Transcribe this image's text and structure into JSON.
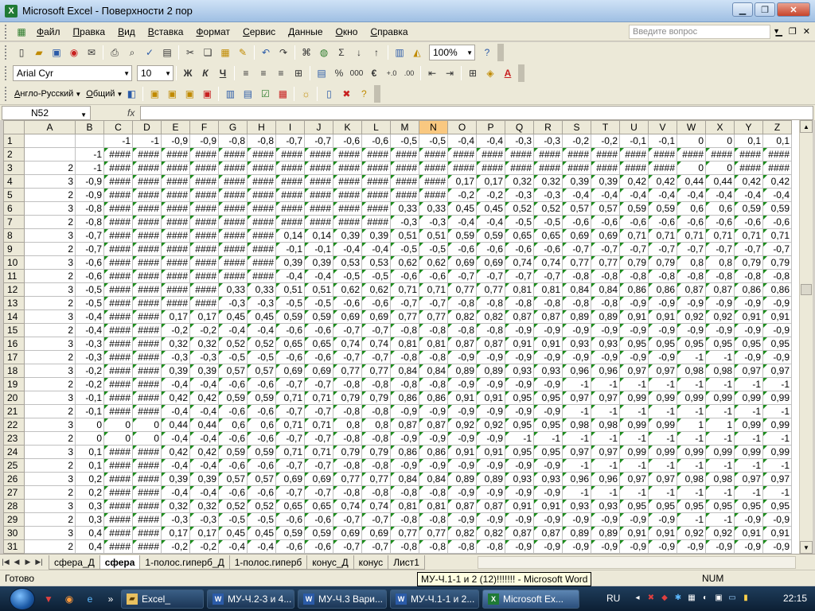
{
  "window": {
    "title": "Microsoft Excel - Поверхности 2 пор"
  },
  "menu": {
    "items": [
      "Файл",
      "Правка",
      "Вид",
      "Вставка",
      "Формат",
      "Сервис",
      "Данные",
      "Окно",
      "Справка"
    ],
    "question_placeholder": "Введите вопрос"
  },
  "toolbar": {
    "zoom": "100%",
    "font_name": "Arial Cyr",
    "font_size": "10",
    "bold": "Ж",
    "italic": "К",
    "underline": "Ч",
    "percent": "%",
    "thousands": "000",
    "euro": "€",
    "language": "Англо-Русский",
    "dictionary": "Общий"
  },
  "formula_bar": {
    "name_box": "N52",
    "fx_label": "fx",
    "formula": ""
  },
  "sheet": {
    "columns": [
      "A",
      "B",
      "C",
      "D",
      "E",
      "F",
      "G",
      "H",
      "I",
      "J",
      "K",
      "L",
      "M",
      "N",
      "O",
      "P",
      "Q",
      "R",
      "S",
      "T",
      "U",
      "V",
      "W",
      "X",
      "Y",
      "Z"
    ],
    "selected_column": "N",
    "rows": [
      {
        "n": "1",
        "c": [
          "",
          "",
          "-1",
          "-1",
          "-0,9",
          "-0,9",
          "-0,8",
          "-0,8",
          "-0,7",
          "-0,7",
          "-0,6",
          "-0,6",
          "-0,5",
          "-0,5",
          "-0,4",
          "-0,4",
          "-0,3",
          "-0,3",
          "-0,2",
          "-0,2",
          "-0,1",
          "-0,1",
          "0",
          "0",
          "0,1",
          "0,1"
        ]
      },
      {
        "n": "2",
        "c": [
          "",
          "-1",
          "####",
          "####",
          "####",
          "####",
          "####",
          "####",
          "####",
          "####",
          "####",
          "####",
          "####",
          "####",
          "####",
          "####",
          "####",
          "####",
          "####",
          "####",
          "####",
          "####",
          "####",
          "####",
          "####",
          "####"
        ]
      },
      {
        "n": "3",
        "c": [
          "2",
          "-1",
          "####",
          "####",
          "####",
          "####",
          "####",
          "####",
          "####",
          "####",
          "####",
          "####",
          "####",
          "####",
          "####",
          "####",
          "####",
          "####",
          "####",
          "####",
          "####",
          "####",
          "0",
          "0",
          "####",
          "####"
        ]
      },
      {
        "n": "4",
        "c": [
          "3",
          "-0,9",
          "####",
          "####",
          "####",
          "####",
          "####",
          "####",
          "####",
          "####",
          "####",
          "####",
          "####",
          "####",
          "0,17",
          "0,17",
          "0,32",
          "0,32",
          "0,39",
          "0,39",
          "0,42",
          "0,42",
          "0,44",
          "0,44",
          "0,42",
          "0,42"
        ]
      },
      {
        "n": "5",
        "c": [
          "2",
          "-0,9",
          "####",
          "####",
          "####",
          "####",
          "####",
          "####",
          "####",
          "####",
          "####",
          "####",
          "####",
          "####",
          "-0,2",
          "-0,2",
          "-0,3",
          "-0,3",
          "-0,4",
          "-0,4",
          "-0,4",
          "-0,4",
          "-0,4",
          "-0,4",
          "-0,4",
          "-0,4"
        ]
      },
      {
        "n": "6",
        "c": [
          "3",
          "-0,8",
          "####",
          "####",
          "####",
          "####",
          "####",
          "####",
          "####",
          "####",
          "####",
          "####",
          "0,33",
          "0,33",
          "0,45",
          "0,45",
          "0,52",
          "0,52",
          "0,57",
          "0,57",
          "0,59",
          "0,59",
          "0,6",
          "0,6",
          "0,59",
          "0,59"
        ]
      },
      {
        "n": "7",
        "c": [
          "2",
          "-0,8",
          "####",
          "####",
          "####",
          "####",
          "####",
          "####",
          "####",
          "####",
          "####",
          "####",
          "-0,3",
          "-0,3",
          "-0,4",
          "-0,4",
          "-0,5",
          "-0,5",
          "-0,6",
          "-0,6",
          "-0,6",
          "-0,6",
          "-0,6",
          "-0,6",
          "-0,6",
          "-0,6"
        ]
      },
      {
        "n": "8",
        "c": [
          "3",
          "-0,7",
          "####",
          "####",
          "####",
          "####",
          "####",
          "####",
          "0,14",
          "0,14",
          "0,39",
          "0,39",
          "0,51",
          "0,51",
          "0,59",
          "0,59",
          "0,65",
          "0,65",
          "0,69",
          "0,69",
          "0,71",
          "0,71",
          "0,71",
          "0,71",
          "0,71",
          "0,71"
        ]
      },
      {
        "n": "9",
        "c": [
          "2",
          "-0,7",
          "####",
          "####",
          "####",
          "####",
          "####",
          "####",
          "-0,1",
          "-0,1",
          "-0,4",
          "-0,4",
          "-0,5",
          "-0,5",
          "-0,6",
          "-0,6",
          "-0,6",
          "-0,6",
          "-0,7",
          "-0,7",
          "-0,7",
          "-0,7",
          "-0,7",
          "-0,7",
          "-0,7",
          "-0,7"
        ]
      },
      {
        "n": "10",
        "c": [
          "3",
          "-0,6",
          "####",
          "####",
          "####",
          "####",
          "####",
          "####",
          "0,39",
          "0,39",
          "0,53",
          "0,53",
          "0,62",
          "0,62",
          "0,69",
          "0,69",
          "0,74",
          "0,74",
          "0,77",
          "0,77",
          "0,79",
          "0,79",
          "0,8",
          "0,8",
          "0,79",
          "0,79"
        ]
      },
      {
        "n": "11",
        "c": [
          "2",
          "-0,6",
          "####",
          "####",
          "####",
          "####",
          "####",
          "####",
          "-0,4",
          "-0,4",
          "-0,5",
          "-0,5",
          "-0,6",
          "-0,6",
          "-0,7",
          "-0,7",
          "-0,7",
          "-0,7",
          "-0,8",
          "-0,8",
          "-0,8",
          "-0,8",
          "-0,8",
          "-0,8",
          "-0,8",
          "-0,8"
        ]
      },
      {
        "n": "12",
        "c": [
          "3",
          "-0,5",
          "####",
          "####",
          "####",
          "####",
          "0,33",
          "0,33",
          "0,51",
          "0,51",
          "0,62",
          "0,62",
          "0,71",
          "0,71",
          "0,77",
          "0,77",
          "0,81",
          "0,81",
          "0,84",
          "0,84",
          "0,86",
          "0,86",
          "0,87",
          "0,87",
          "0,86",
          "0,86"
        ]
      },
      {
        "n": "13",
        "c": [
          "2",
          "-0,5",
          "####",
          "####",
          "####",
          "####",
          "-0,3",
          "-0,3",
          "-0,5",
          "-0,5",
          "-0,6",
          "-0,6",
          "-0,7",
          "-0,7",
          "-0,8",
          "-0,8",
          "-0,8",
          "-0,8",
          "-0,8",
          "-0,8",
          "-0,9",
          "-0,9",
          "-0,9",
          "-0,9",
          "-0,9",
          "-0,9"
        ]
      },
      {
        "n": "14",
        "c": [
          "3",
          "-0,4",
          "####",
          "####",
          "0,17",
          "0,17",
          "0,45",
          "0,45",
          "0,59",
          "0,59",
          "0,69",
          "0,69",
          "0,77",
          "0,77",
          "0,82",
          "0,82",
          "0,87",
          "0,87",
          "0,89",
          "0,89",
          "0,91",
          "0,91",
          "0,92",
          "0,92",
          "0,91",
          "0,91"
        ]
      },
      {
        "n": "15",
        "c": [
          "2",
          "-0,4",
          "####",
          "####",
          "-0,2",
          "-0,2",
          "-0,4",
          "-0,4",
          "-0,6",
          "-0,6",
          "-0,7",
          "-0,7",
          "-0,8",
          "-0,8",
          "-0,8",
          "-0,8",
          "-0,9",
          "-0,9",
          "-0,9",
          "-0,9",
          "-0,9",
          "-0,9",
          "-0,9",
          "-0,9",
          "-0,9",
          "-0,9"
        ]
      },
      {
        "n": "16",
        "c": [
          "3",
          "-0,3",
          "####",
          "####",
          "0,32",
          "0,32",
          "0,52",
          "0,52",
          "0,65",
          "0,65",
          "0,74",
          "0,74",
          "0,81",
          "0,81",
          "0,87",
          "0,87",
          "0,91",
          "0,91",
          "0,93",
          "0,93",
          "0,95",
          "0,95",
          "0,95",
          "0,95",
          "0,95",
          "0,95"
        ]
      },
      {
        "n": "17",
        "c": [
          "2",
          "-0,3",
          "####",
          "####",
          "-0,3",
          "-0,3",
          "-0,5",
          "-0,5",
          "-0,6",
          "-0,6",
          "-0,7",
          "-0,7",
          "-0,8",
          "-0,8",
          "-0,9",
          "-0,9",
          "-0,9",
          "-0,9",
          "-0,9",
          "-0,9",
          "-0,9",
          "-0,9",
          "-1",
          "-1",
          "-0,9",
          "-0,9"
        ]
      },
      {
        "n": "18",
        "c": [
          "3",
          "-0,2",
          "####",
          "####",
          "0,39",
          "0,39",
          "0,57",
          "0,57",
          "0,69",
          "0,69",
          "0,77",
          "0,77",
          "0,84",
          "0,84",
          "0,89",
          "0,89",
          "0,93",
          "0,93",
          "0,96",
          "0,96",
          "0,97",
          "0,97",
          "0,98",
          "0,98",
          "0,97",
          "0,97"
        ]
      },
      {
        "n": "19",
        "c": [
          "2",
          "-0,2",
          "####",
          "####",
          "-0,4",
          "-0,4",
          "-0,6",
          "-0,6",
          "-0,7",
          "-0,7",
          "-0,8",
          "-0,8",
          "-0,8",
          "-0,8",
          "-0,9",
          "-0,9",
          "-0,9",
          "-0,9",
          "-1",
          "-1",
          "-1",
          "-1",
          "-1",
          "-1",
          "-1",
          "-1"
        ]
      },
      {
        "n": "20",
        "c": [
          "3",
          "-0,1",
          "####",
          "####",
          "0,42",
          "0,42",
          "0,59",
          "0,59",
          "0,71",
          "0,71",
          "0,79",
          "0,79",
          "0,86",
          "0,86",
          "0,91",
          "0,91",
          "0,95",
          "0,95",
          "0,97",
          "0,97",
          "0,99",
          "0,99",
          "0,99",
          "0,99",
          "0,99",
          "0,99"
        ]
      },
      {
        "n": "21",
        "c": [
          "2",
          "-0,1",
          "####",
          "####",
          "-0,4",
          "-0,4",
          "-0,6",
          "-0,6",
          "-0,7",
          "-0,7",
          "-0,8",
          "-0,8",
          "-0,9",
          "-0,9",
          "-0,9",
          "-0,9",
          "-0,9",
          "-0,9",
          "-1",
          "-1",
          "-1",
          "-1",
          "-1",
          "-1",
          "-1",
          "-1"
        ]
      },
      {
        "n": "22",
        "c": [
          "3",
          "0",
          "0",
          "0",
          "0,44",
          "0,44",
          "0,6",
          "0,6",
          "0,71",
          "0,71",
          "0,8",
          "0,8",
          "0,87",
          "0,87",
          "0,92",
          "0,92",
          "0,95",
          "0,95",
          "0,98",
          "0,98",
          "0,99",
          "0,99",
          "1",
          "1",
          "0,99",
          "0,99"
        ]
      },
      {
        "n": "23",
        "c": [
          "2",
          "0",
          "0",
          "0",
          "-0,4",
          "-0,4",
          "-0,6",
          "-0,6",
          "-0,7",
          "-0,7",
          "-0,8",
          "-0,8",
          "-0,9",
          "-0,9",
          "-0,9",
          "-0,9",
          "-1",
          "-1",
          "-1",
          "-1",
          "-1",
          "-1",
          "-1",
          "-1",
          "-1",
          "-1"
        ]
      },
      {
        "n": "24",
        "c": [
          "3",
          "0,1",
          "####",
          "####",
          "0,42",
          "0,42",
          "0,59",
          "0,59",
          "0,71",
          "0,71",
          "0,79",
          "0,79",
          "0,86",
          "0,86",
          "0,91",
          "0,91",
          "0,95",
          "0,95",
          "0,97",
          "0,97",
          "0,99",
          "0,99",
          "0,99",
          "0,99",
          "0,99",
          "0,99"
        ]
      },
      {
        "n": "25",
        "c": [
          "2",
          "0,1",
          "####",
          "####",
          "-0,4",
          "-0,4",
          "-0,6",
          "-0,6",
          "-0,7",
          "-0,7",
          "-0,8",
          "-0,8",
          "-0,9",
          "-0,9",
          "-0,9",
          "-0,9",
          "-0,9",
          "-0,9",
          "-1",
          "-1",
          "-1",
          "-1",
          "-1",
          "-1",
          "-1",
          "-1"
        ]
      },
      {
        "n": "26",
        "c": [
          "3",
          "0,2",
          "####",
          "####",
          "0,39",
          "0,39",
          "0,57",
          "0,57",
          "0,69",
          "0,69",
          "0,77",
          "0,77",
          "0,84",
          "0,84",
          "0,89",
          "0,89",
          "0,93",
          "0,93",
          "0,96",
          "0,96",
          "0,97",
          "0,97",
          "0,98",
          "0,98",
          "0,97",
          "0,97"
        ]
      },
      {
        "n": "27",
        "c": [
          "2",
          "0,2",
          "####",
          "####",
          "-0,4",
          "-0,4",
          "-0,6",
          "-0,6",
          "-0,7",
          "-0,7",
          "-0,8",
          "-0,8",
          "-0,8",
          "-0,8",
          "-0,9",
          "-0,9",
          "-0,9",
          "-0,9",
          "-1",
          "-1",
          "-1",
          "-1",
          "-1",
          "-1",
          "-1",
          "-1"
        ]
      },
      {
        "n": "28",
        "c": [
          "3",
          "0,3",
          "####",
          "####",
          "0,32",
          "0,32",
          "0,52",
          "0,52",
          "0,65",
          "0,65",
          "0,74",
          "0,74",
          "0,81",
          "0,81",
          "0,87",
          "0,87",
          "0,91",
          "0,91",
          "0,93",
          "0,93",
          "0,95",
          "0,95",
          "0,95",
          "0,95",
          "0,95",
          "0,95"
        ]
      },
      {
        "n": "29",
        "c": [
          "2",
          "0,3",
          "####",
          "####",
          "-0,3",
          "-0,3",
          "-0,5",
          "-0,5",
          "-0,6",
          "-0,6",
          "-0,7",
          "-0,7",
          "-0,8",
          "-0,8",
          "-0,9",
          "-0,9",
          "-0,9",
          "-0,9",
          "-0,9",
          "-0,9",
          "-0,9",
          "-0,9",
          "-1",
          "-1",
          "-0,9",
          "-0,9"
        ]
      },
      {
        "n": "30",
        "c": [
          "3",
          "0,4",
          "####",
          "####",
          "0,17",
          "0,17",
          "0,45",
          "0,45",
          "0,59",
          "0,59",
          "0,69",
          "0,69",
          "0,77",
          "0,77",
          "0,82",
          "0,82",
          "0,87",
          "0,87",
          "0,89",
          "0,89",
          "0,91",
          "0,91",
          "0,92",
          "0,92",
          "0,91",
          "0,91"
        ]
      },
      {
        "n": "31",
        "c": [
          "2",
          "0,4",
          "####",
          "####",
          "-0,2",
          "-0,2",
          "-0,4",
          "-0,4",
          "-0,6",
          "-0,6",
          "-0,7",
          "-0,7",
          "-0,8",
          "-0,8",
          "-0,8",
          "-0,8",
          "-0,9",
          "-0,9",
          "-0,9",
          "-0,9",
          "-0,9",
          "-0,9",
          "-0,9",
          "-0,9",
          "-0,9",
          "-0,9"
        ]
      }
    ]
  },
  "sheet_tabs": {
    "items": [
      "сфера_Д",
      "сфера",
      "1-полос.гиперб_Д",
      "1-полос.гиперб",
      "конус_Д",
      "конус",
      "Лист1"
    ],
    "active": "сфера"
  },
  "status": {
    "ready": "Готово",
    "num": "NUM",
    "tooltip": "МУ-Ч.1-1 и 2 (12)!!!!!!! - Microsoft Word"
  },
  "taskbar": {
    "buttons": [
      "Excel_",
      "МУ-Ч.2-3 и 4...",
      "МУ-Ч.3 Вари...",
      "МУ-Ч.1-1 и 2...",
      "Microsoft Ex..."
    ],
    "language": "RU",
    "clock": "22:15"
  },
  "colors": {
    "title_bar": "#9fbfe3",
    "taskbar": "#1f3d5c",
    "selected_column_header": "#f9c880",
    "error_triangle": "#1a8c1a"
  }
}
